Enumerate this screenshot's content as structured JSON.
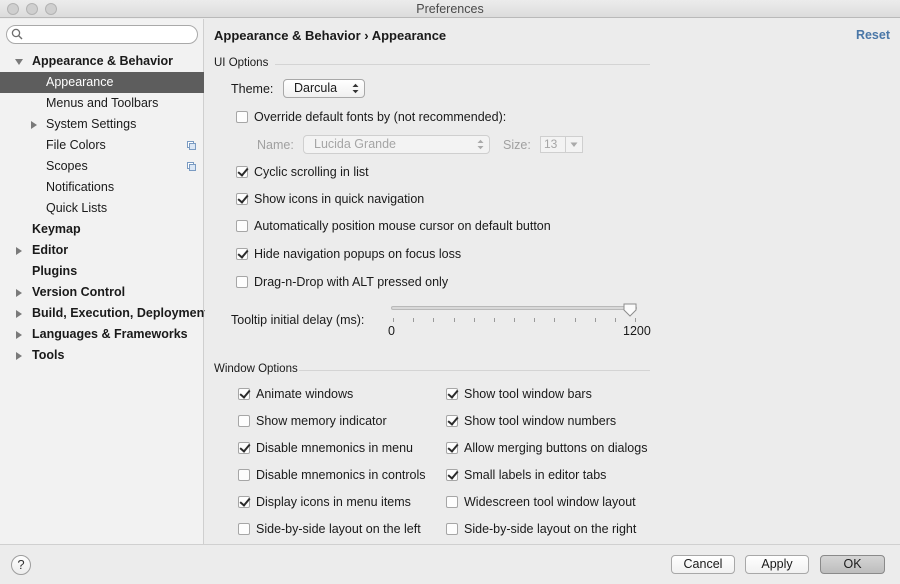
{
  "window": {
    "title": "Preferences"
  },
  "sidebar": {
    "search_value": "",
    "items": [
      {
        "label": "Appearance & Behavior",
        "expanded": true
      },
      {
        "label": "Appearance",
        "selected": true
      },
      {
        "label": "Menus and Toolbars"
      },
      {
        "label": "System Settings"
      },
      {
        "label": "File Colors"
      },
      {
        "label": "Scopes"
      },
      {
        "label": "Notifications"
      },
      {
        "label": "Quick Lists"
      },
      {
        "label": "Keymap"
      },
      {
        "label": "Editor"
      },
      {
        "label": "Plugins"
      },
      {
        "label": "Version Control"
      },
      {
        "label": "Build, Execution, Deployment"
      },
      {
        "label": "Languages & Frameworks"
      },
      {
        "label": "Tools"
      }
    ]
  },
  "header": {
    "breadcrumb": "Appearance & Behavior › Appearance",
    "reset_label": "Reset"
  },
  "ui_options": {
    "title": "UI Options",
    "theme_label": "Theme:",
    "theme_value": "Darcula",
    "override_fonts": {
      "label": "Override default fonts by (not recommended):",
      "checked": false
    },
    "name_label": "Name:",
    "name_value": "Lucida Grande",
    "size_label": "Size:",
    "size_value": "13",
    "checkboxes": [
      {
        "label": "Cyclic scrolling in list",
        "checked": true
      },
      {
        "label": "Show icons in quick navigation",
        "checked": true
      },
      {
        "label": "Automatically position mouse cursor on default button",
        "checked": false
      },
      {
        "label": "Hide navigation popups on focus loss",
        "checked": true
      },
      {
        "label": "Drag-n-Drop with ALT pressed only",
        "checked": false
      }
    ],
    "tooltip_label": "Tooltip initial delay (ms):",
    "slider": {
      "min_label": "0",
      "max_label": "1200",
      "value": 1200,
      "min": 0,
      "max": 1200
    }
  },
  "window_options": {
    "title": "Window Options",
    "left": [
      {
        "label": "Animate windows",
        "checked": true
      },
      {
        "label": "Show memory indicator",
        "checked": false
      },
      {
        "label": "Disable mnemonics in menu",
        "checked": true
      },
      {
        "label": "Disable mnemonics in controls",
        "checked": false
      },
      {
        "label": "Display icons in menu items",
        "checked": true
      },
      {
        "label": "Side-by-side layout on the left",
        "checked": false
      }
    ],
    "right": [
      {
        "label": "Show tool window bars",
        "checked": true
      },
      {
        "label": "Show tool window numbers",
        "checked": true
      },
      {
        "label": "Allow merging buttons on dialogs",
        "checked": true
      },
      {
        "label": "Small labels in editor tabs",
        "checked": true
      },
      {
        "label": "Widescreen tool window layout",
        "checked": false
      },
      {
        "label": "Side-by-side layout on the right",
        "checked": false
      }
    ]
  },
  "footer": {
    "help_label": "?",
    "cancel_label": "Cancel",
    "apply_label": "Apply",
    "ok_label": "OK"
  }
}
